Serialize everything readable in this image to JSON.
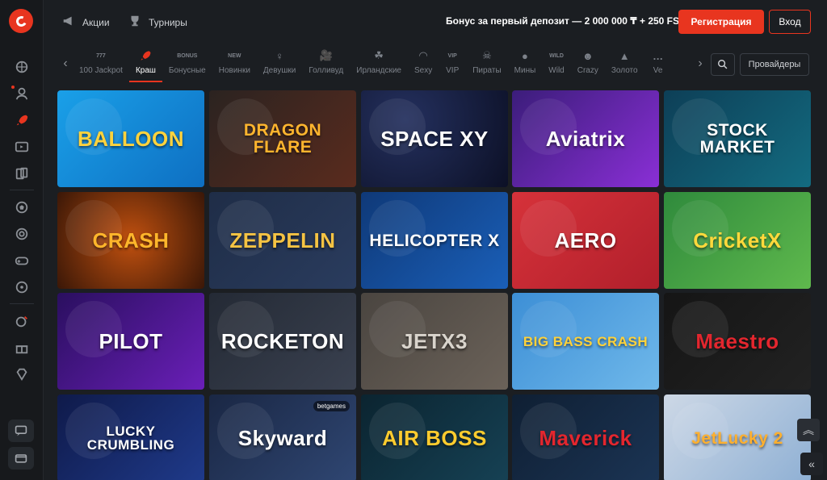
{
  "header": {
    "promo_label": "Акции",
    "tournaments_label": "Турниры",
    "bonus_text": "Бонус за первый депозит — 2 000 000 ₸ + 250 FS",
    "register_label": "Регистрация",
    "login_label": "Вход"
  },
  "colors": {
    "accent": "#e8351f",
    "background": "#1b1e22",
    "rail": "#17191c"
  },
  "rail_icons": [
    "sport-icon",
    "live-dealer-icon",
    "rocket-icon",
    "tv-icon",
    "cards-icon",
    "football-icon",
    "target-icon",
    "gamepad-icon",
    "live-casino-icon",
    "lottery-icon",
    "gift-icon",
    "diamond-icon"
  ],
  "rail_bottom": [
    "chat-icon",
    "wallet-icon"
  ],
  "categories": [
    {
      "label": "100 Jackpot",
      "icon": "jackpot-icon"
    },
    {
      "label": "Краш",
      "icon": "rocket-icon",
      "active": true
    },
    {
      "label": "Бонусные",
      "icon": "bonus-icon"
    },
    {
      "label": "Новинки",
      "icon": "new-icon"
    },
    {
      "label": "Девушки",
      "icon": "girl-icon"
    },
    {
      "label": "Голливуд",
      "icon": "camera-icon"
    },
    {
      "label": "Ирландские",
      "icon": "clover-icon"
    },
    {
      "label": "Sexy",
      "icon": "lips-icon"
    },
    {
      "label": "VIP",
      "icon": "vip-icon"
    },
    {
      "label": "Пираты",
      "icon": "pirate-icon"
    },
    {
      "label": "Мины",
      "icon": "mine-icon"
    },
    {
      "label": "Wild",
      "icon": "wild-icon"
    },
    {
      "label": "Crazy",
      "icon": "crazy-icon"
    },
    {
      "label": "Золото",
      "icon": "gold-icon"
    },
    {
      "label": "Ve",
      "icon": "more-icon"
    }
  ],
  "search_icon": "search-icon",
  "providers_label": "Провайдеры",
  "games": [
    {
      "title": "BALLOON",
      "bg": "linear-gradient(135deg,#1aa0e8,#0e6fc2)",
      "color": "#ffd33d"
    },
    {
      "title": "DRAGON FLARE",
      "bg": "linear-gradient(135deg,#2b2320,#5a2b1e)",
      "color": "#ffb52e"
    },
    {
      "title": "SPACE XY",
      "bg": "radial-gradient(circle at 30% 30%,#24305e,#0c1026)",
      "color": "#ffffff"
    },
    {
      "title": "Aviatrix",
      "bg": "linear-gradient(135deg,#3b1d7a,#8a2fd6)",
      "color": "#ffffff"
    },
    {
      "title": "STOCK MARKET",
      "bg": "linear-gradient(135deg,#0d3f57,#136b80)",
      "color": "#ffffff"
    },
    {
      "title": "CRASH",
      "bg": "radial-gradient(circle at 50% 50%,#c0500f,#3a1707)",
      "color": "#ffb62b"
    },
    {
      "title": "ZEPPELIN",
      "bg": "linear-gradient(135deg,#1f2d47,#2a3c5e)",
      "color": "#f5c343"
    },
    {
      "title": "HELICOPTER X",
      "bg": "linear-gradient(135deg,#0f3978,#1a5fb8)",
      "color": "#ffffff"
    },
    {
      "title": "AERO",
      "bg": "linear-gradient(135deg,#d6323a,#b11f2b)",
      "color": "#ffffff"
    },
    {
      "title": "CricketX",
      "bg": "linear-gradient(135deg,#2f8a3c,#5fb94d)",
      "color": "#ffd93c"
    },
    {
      "title": "PILOT",
      "bg": "linear-gradient(135deg,#2a0f5f,#6a1fb8)",
      "color": "#ffffff"
    },
    {
      "title": "ROCKETON",
      "bg": "linear-gradient(135deg,#242a35,#3a4150)",
      "color": "#ffffff"
    },
    {
      "title": "JETX3",
      "bg": "linear-gradient(135deg,#4a4540,#6b6259)",
      "color": "#d9d4cc"
    },
    {
      "title": "BIG BASS CRASH",
      "bg": "linear-gradient(135deg,#3d8fd6,#6fb8ea)",
      "color": "#ffd23a"
    },
    {
      "title": "Maestro",
      "bg": "linear-gradient(135deg,#151515,#222222)",
      "color": "#e3262e"
    },
    {
      "title": "LUCKY CRUMBLING",
      "bg": "linear-gradient(135deg,#0f1a4a,#1f3a8a)",
      "color": "#ffffff"
    },
    {
      "title": "Skyward",
      "bg": "linear-gradient(135deg,#1a2744,#2f4672)",
      "color": "#ffffff",
      "tag": "betgames"
    },
    {
      "title": "AIR BOSS",
      "bg": "linear-gradient(135deg,#0b2430,#164154)",
      "color": "#ffcc2e"
    },
    {
      "title": "Maverick",
      "bg": "linear-gradient(135deg,#0f1f33,#1b3454)",
      "color": "#e3262e"
    },
    {
      "title": "JetLucky 2",
      "bg": "linear-gradient(135deg,#cdd8e6,#8fb0d4)",
      "color": "#ffb02e"
    }
  ],
  "scroll_top_icon": "double-chevron-up-icon",
  "collapse_icon": "double-chevron-left-icon"
}
